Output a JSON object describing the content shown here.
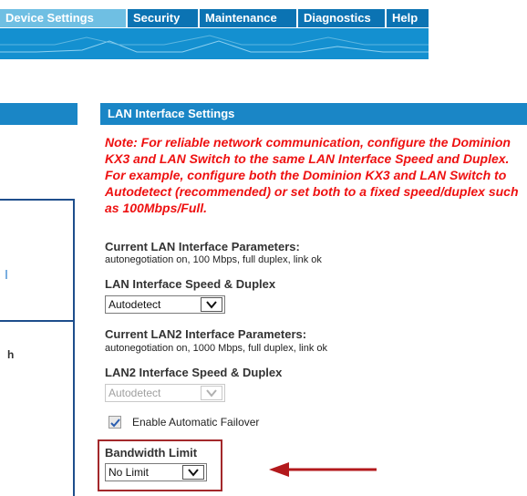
{
  "nav": {
    "tabs": [
      {
        "label": "Device Settings",
        "active": true
      },
      {
        "label": "Security",
        "active": false
      },
      {
        "label": "Maintenance",
        "active": false
      },
      {
        "label": "Diagnostics",
        "active": false
      },
      {
        "label": "Help",
        "active": false
      }
    ]
  },
  "left_panel": {
    "fragment_letter": "h"
  },
  "section": {
    "title": "LAN Interface Settings",
    "note": "Note: For reliable network communication, configure the Dominion KX3 and LAN Switch to the same LAN Interface Speed and Duplex. For example, configure both the Dominion KX3 and LAN Switch to Autodetect (recommended) or set both to a fixed speed/duplex such as 100Mbps/Full."
  },
  "lan1": {
    "params_title": "Current LAN Interface Parameters:",
    "params_value": "autonegotiation on, 100 Mbps, full duplex, link ok",
    "speed_label": "LAN Interface Speed & Duplex",
    "speed_value": "Autodetect"
  },
  "lan2": {
    "params_title": "Current LAN2 Interface Parameters:",
    "params_value": "autonegotiation on, 1000 Mbps, full duplex, link ok",
    "speed_label": "LAN2 Interface Speed & Duplex",
    "speed_value": "Autodetect",
    "speed_disabled": true
  },
  "failover": {
    "label": "Enable Automatic Failover",
    "checked": true
  },
  "bandwidth": {
    "label": "Bandwidth Limit",
    "value": "No Limit"
  },
  "colors": {
    "nav_tab": "#0B73B3",
    "nav_tab_active": "#6FBFE3",
    "header_bar": "#1A86C6",
    "note_text": "#EE1111",
    "highlight_border": "#A3282B",
    "arrow": "#B3191C"
  },
  "icons": [
    "chevron-down-icon",
    "checkmark-icon",
    "left-arrow-icon"
  ]
}
